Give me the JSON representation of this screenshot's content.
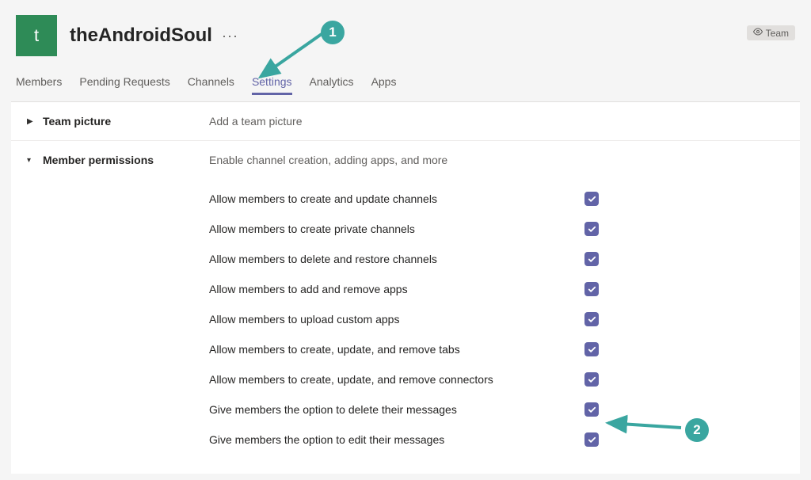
{
  "header": {
    "avatar_letter": "t",
    "team_name": "theAndroidSoul",
    "team_badge": "Team"
  },
  "tabs": [
    {
      "id": "members",
      "label": "Members"
    },
    {
      "id": "pending",
      "label": "Pending Requests"
    },
    {
      "id": "channels",
      "label": "Channels"
    },
    {
      "id": "settings",
      "label": "Settings",
      "active": true
    },
    {
      "id": "analytics",
      "label": "Analytics"
    },
    {
      "id": "apps",
      "label": "Apps"
    }
  ],
  "sections": {
    "team_picture": {
      "title": "Team picture",
      "description": "Add a team picture"
    },
    "member_permissions": {
      "title": "Member permissions",
      "description": "Enable channel creation, adding apps, and more",
      "items": [
        {
          "label": "Allow members to create and update channels",
          "checked": true
        },
        {
          "label": "Allow members to create private channels",
          "checked": true
        },
        {
          "label": "Allow members to delete and restore channels",
          "checked": true
        },
        {
          "label": "Allow members to add and remove apps",
          "checked": true
        },
        {
          "label": "Allow members to upload custom apps",
          "checked": true
        },
        {
          "label": "Allow members to create, update, and remove tabs",
          "checked": true
        },
        {
          "label": "Allow members to create, update, and remove connectors",
          "checked": true
        },
        {
          "label": "Give members the option to delete their messages",
          "checked": true
        },
        {
          "label": "Give members the option to edit their messages",
          "checked": true
        }
      ]
    }
  },
  "annotations": {
    "badge1": "1",
    "badge2": "2",
    "color": "#3aa6a0"
  }
}
